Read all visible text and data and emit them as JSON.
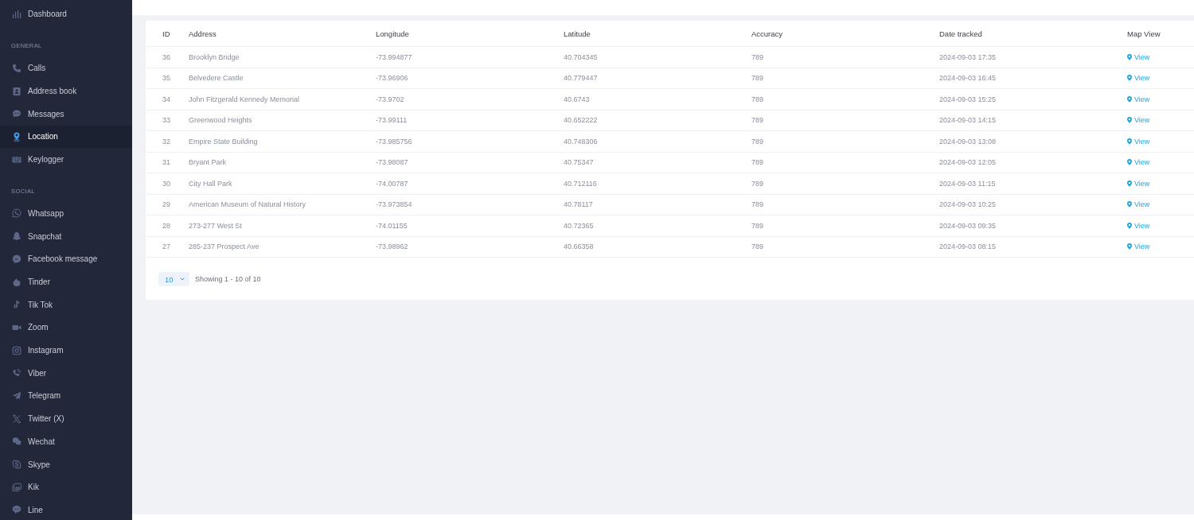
{
  "sidebar": {
    "items": [
      {
        "label": "Dashboard",
        "selected": false
      }
    ],
    "sections": [
      {
        "title": "GENERAL",
        "items": [
          {
            "label": "Calls",
            "selected": false
          },
          {
            "label": "Address book",
            "selected": false
          },
          {
            "label": "Messages",
            "selected": false
          },
          {
            "label": "Location",
            "selected": true
          },
          {
            "label": "Keylogger",
            "selected": false
          }
        ]
      },
      {
        "title": "SOCIAL",
        "items": [
          {
            "label": "Whatsapp",
            "selected": false
          },
          {
            "label": "Snapchat",
            "selected": false
          },
          {
            "label": "Facebook message",
            "selected": false
          },
          {
            "label": "Tinder",
            "selected": false
          },
          {
            "label": "Tik Tok",
            "selected": false
          },
          {
            "label": "Zoom",
            "selected": false
          },
          {
            "label": "Instagram",
            "selected": false
          },
          {
            "label": "Viber",
            "selected": false
          },
          {
            "label": "Telegram",
            "selected": false
          },
          {
            "label": "Twitter (X)",
            "selected": false
          },
          {
            "label": "Wechat",
            "selected": false
          },
          {
            "label": "Skype",
            "selected": false
          },
          {
            "label": "Kik",
            "selected": false
          },
          {
            "label": "Line",
            "selected": false
          }
        ]
      }
    ]
  },
  "table": {
    "columns": [
      "ID",
      "Address",
      "Longitude",
      "Latitude",
      "Accuracy",
      "Date tracked",
      "Map View"
    ],
    "rows": [
      {
        "id": "36",
        "address": "Brooklyn Bridge",
        "longitude": "-73.994877",
        "latitude": "40.704345",
        "accuracy": "789",
        "date_tracked": "2024-09-03 17:35",
        "map_view": "View"
      },
      {
        "id": "35",
        "address": "Belvedere Castle",
        "longitude": "-73.96906",
        "latitude": "40.779447",
        "accuracy": "789",
        "date_tracked": "2024-09-03 16:45",
        "map_view": "View"
      },
      {
        "id": "34",
        "address": "John Fitzgerald Kennedy Memorial",
        "longitude": "-73.9702",
        "latitude": "40.6743",
        "accuracy": "789",
        "date_tracked": "2024-09-03 15:25",
        "map_view": "View"
      },
      {
        "id": "33",
        "address": "Greenwood Heights",
        "longitude": "-73.99111",
        "latitude": "40.652222",
        "accuracy": "789",
        "date_tracked": "2024-09-03 14:15",
        "map_view": "View"
      },
      {
        "id": "32",
        "address": "Empire State Building",
        "longitude": "-73.985756",
        "latitude": "40.748306",
        "accuracy": "789",
        "date_tracked": "2024-09-03 13:08",
        "map_view": "View"
      },
      {
        "id": "31",
        "address": "Bryant Park",
        "longitude": "-73.98087",
        "latitude": "40.75347",
        "accuracy": "789",
        "date_tracked": "2024-09-03 12:05",
        "map_view": "View"
      },
      {
        "id": "30",
        "address": "City Hall Park",
        "longitude": "-74.00787",
        "latitude": "40.712116",
        "accuracy": "789",
        "date_tracked": "2024-09-03 11:15",
        "map_view": "View"
      },
      {
        "id": "29",
        "address": "American Museum of Natural History",
        "longitude": "-73.973854",
        "latitude": "40.78117",
        "accuracy": "789",
        "date_tracked": "2024-09-03 10:25",
        "map_view": "View"
      },
      {
        "id": "28",
        "address": "273-277 West St",
        "longitude": "-74.01155",
        "latitude": "40.72365",
        "accuracy": "789",
        "date_tracked": "2024-09-03 09:35",
        "map_view": "View"
      },
      {
        "id": "27",
        "address": "285-237 Prospect Ave",
        "longitude": "-73.98962",
        "latitude": "40.66358",
        "accuracy": "789",
        "date_tracked": "2024-09-03 08:15",
        "map_view": "View"
      }
    ]
  },
  "pagination": {
    "page_size": "10",
    "summary": "Showing 1 - 10 of 10"
  }
}
